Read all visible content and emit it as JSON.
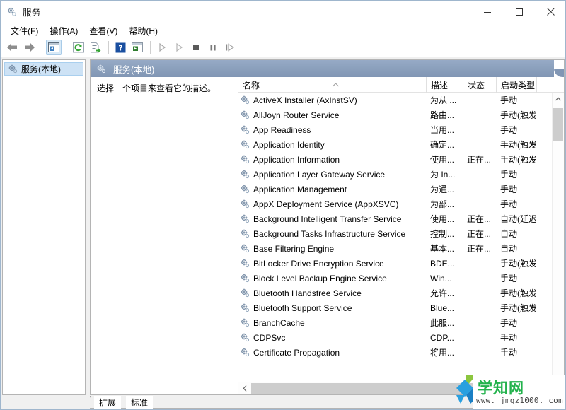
{
  "window": {
    "title": "服务",
    "icon": "services-gear-icon",
    "controls": {
      "minimize": "最小化",
      "maximize": "最大化",
      "close": "关闭"
    }
  },
  "menubar": {
    "items": [
      {
        "label": "文件(F)",
        "name": "menu-file"
      },
      {
        "label": "操作(A)",
        "name": "menu-action"
      },
      {
        "label": "查看(V)",
        "name": "menu-view"
      },
      {
        "label": "帮助(H)",
        "name": "menu-help"
      }
    ]
  },
  "toolbar": {
    "buttons": [
      {
        "icon": "back-arrow-icon",
        "name": "toolbar-back"
      },
      {
        "icon": "forward-arrow-icon",
        "name": "toolbar-forward"
      },
      {
        "icon": "show-hide-console-tree-icon",
        "name": "toolbar-show-tree",
        "pressed": true
      },
      {
        "icon": "refresh-icon",
        "name": "toolbar-refresh"
      },
      {
        "icon": "export-list-icon",
        "name": "toolbar-export-list"
      },
      {
        "icon": "help-question-icon",
        "name": "toolbar-help"
      },
      {
        "icon": "properties-window-icon",
        "name": "toolbar-properties"
      },
      {
        "icon": "start-service-icon",
        "name": "toolbar-start-service"
      },
      {
        "icon": "resume-service-icon",
        "name": "toolbar-resume-service"
      },
      {
        "icon": "stop-service-icon",
        "name": "toolbar-stop-service"
      },
      {
        "icon": "pause-service-icon",
        "name": "toolbar-pause-service"
      },
      {
        "icon": "restart-service-icon",
        "name": "toolbar-restart-service"
      }
    ]
  },
  "tree": {
    "root": {
      "label": "服务(本地)",
      "icon": "services-node-icon"
    }
  },
  "result_pane": {
    "header": {
      "label": "服务(本地)",
      "icon": "services-node-icon"
    },
    "description_placeholder": "选择一个项目来查看它的描述。"
  },
  "list": {
    "columns": [
      {
        "key": "name",
        "label": "名称",
        "sorted": "asc"
      },
      {
        "key": "desc",
        "label": "描述"
      },
      {
        "key": "status",
        "label": "状态"
      },
      {
        "key": "start",
        "label": "启动类型"
      }
    ],
    "rows": [
      {
        "name": "ActiveX Installer (AxInstSV)",
        "desc": "为从 ...",
        "status": "",
        "start": "手动"
      },
      {
        "name": "AllJoyn Router Service",
        "desc": "路由...",
        "status": "",
        "start": "手动(触发..."
      },
      {
        "name": "App Readiness",
        "desc": "当用...",
        "status": "",
        "start": "手动"
      },
      {
        "name": "Application Identity",
        "desc": "确定...",
        "status": "",
        "start": "手动(触发..."
      },
      {
        "name": "Application Information",
        "desc": "使用...",
        "status": "正在...",
        "start": "手动(触发..."
      },
      {
        "name": "Application Layer Gateway Service",
        "desc": "为 In...",
        "status": "",
        "start": "手动"
      },
      {
        "name": "Application Management",
        "desc": "为通...",
        "status": "",
        "start": "手动"
      },
      {
        "name": "AppX Deployment Service (AppXSVC)",
        "desc": "为部...",
        "status": "",
        "start": "手动"
      },
      {
        "name": "Background Intelligent Transfer Service",
        "desc": "使用...",
        "status": "正在...",
        "start": "自动(延迟..."
      },
      {
        "name": "Background Tasks Infrastructure Service",
        "desc": "控制...",
        "status": "正在...",
        "start": "自动"
      },
      {
        "name": "Base Filtering Engine",
        "desc": "基本...",
        "status": "正在...",
        "start": "自动"
      },
      {
        "name": "BitLocker Drive Encryption Service",
        "desc": "BDE...",
        "status": "",
        "start": "手动(触发..."
      },
      {
        "name": "Block Level Backup Engine Service",
        "desc": "Win...",
        "status": "",
        "start": "手动"
      },
      {
        "name": "Bluetooth Handsfree Service",
        "desc": "允许...",
        "status": "",
        "start": "手动(触发..."
      },
      {
        "name": "Bluetooth Support Service",
        "desc": "Blue...",
        "status": "",
        "start": "手动(触发..."
      },
      {
        "name": "BranchCache",
        "desc": "此服...",
        "status": "",
        "start": "手动"
      },
      {
        "name": "CDPSvc",
        "desc": "CDP...",
        "status": "",
        "start": "手动"
      },
      {
        "name": "Certificate Propagation",
        "desc": "将用...",
        "status": "",
        "start": "手动"
      }
    ]
  },
  "tabs": [
    {
      "label": "扩展",
      "name": "tab-extended",
      "active": false
    },
    {
      "label": "标准",
      "name": "tab-standard",
      "active": true
    }
  ],
  "watermark": {
    "text": "学知网",
    "url": "www. jmqz1000. com"
  },
  "colors": {
    "header_band": "#8ba0bc",
    "tree_selection": "#cde2f5",
    "accent_green": "#22b24c",
    "accent_blue": "#2aa0e0"
  }
}
